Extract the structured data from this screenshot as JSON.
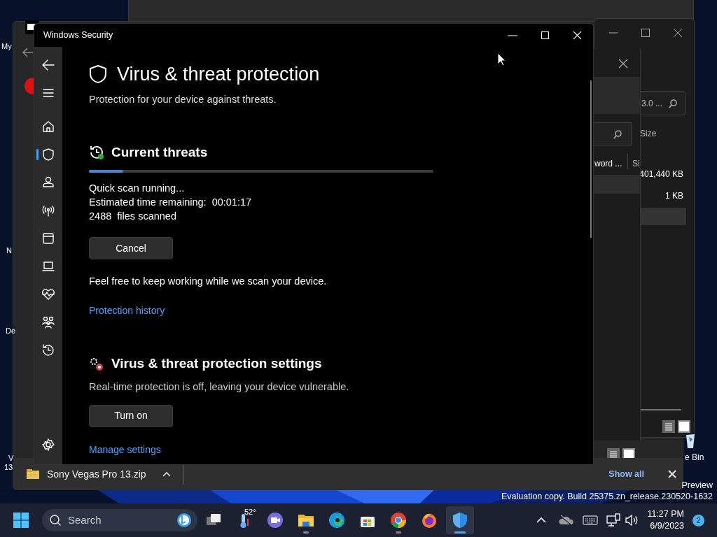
{
  "desktop": {
    "labels": [
      "My",
      "N",
      "De",
      "V",
      "13"
    ],
    "build_info": [
      "Preview",
      "Evaluation copy. Build 25375.zn_release.230520-1632"
    ],
    "recycle_bin_label": "e Bin"
  },
  "browser": {
    "download": {
      "file": "Sony Vegas Pro 13.zip",
      "show_all": "Show all"
    }
  },
  "explorer": {
    "search_value": "3.0 ...",
    "column": "Size",
    "sizes": [
      "401,440 KB",
      "1 KB"
    ]
  },
  "dialog": {
    "column_1": "word ...",
    "column_2": "Si"
  },
  "window": {
    "title": "Windows Security"
  },
  "sidebar": {
    "items": [
      {
        "kind": "home",
        "selected": false
      },
      {
        "kind": "shield",
        "selected": true
      },
      {
        "kind": "person",
        "selected": false
      },
      {
        "kind": "wireless",
        "selected": false
      },
      {
        "kind": "app",
        "selected": false
      },
      {
        "kind": "laptop",
        "selected": false
      },
      {
        "kind": "heart",
        "selected": false
      },
      {
        "kind": "family",
        "selected": false
      },
      {
        "kind": "history",
        "selected": false
      }
    ]
  },
  "page": {
    "title": "Virus & threat protection",
    "subtitle": "Protection for your device against threats."
  },
  "current_threats": {
    "heading": "Current threats",
    "progress": {
      "level": 0.1
    },
    "lines": [
      "Quick scan running...",
      "Estimated time remaining:  00:01:17",
      "2488  files scanned"
    ],
    "button": "Cancel",
    "note": "Feel free to keep working while we scan your device.",
    "link": "Protection history"
  },
  "protection_settings": {
    "heading": "Virus & threat protection settings",
    "status": "Real-time protection is off, leaving your device vulnerable.",
    "button": "Turn on",
    "link": "Manage settings"
  },
  "taskbar": {
    "search_placeholder": "Search",
    "weather": "52°",
    "apps": [
      {
        "kind": "taskview",
        "running": false,
        "selected": false
      },
      {
        "kind": "weather",
        "running": false,
        "selected": false
      },
      {
        "kind": "meet",
        "running": false,
        "selected": false
      },
      {
        "kind": "folder",
        "running": true,
        "selected": false
      },
      {
        "kind": "edge",
        "running": false,
        "selected": false
      },
      {
        "kind": "store",
        "running": false,
        "selected": false
      },
      {
        "kind": "chrome",
        "running": true,
        "selected": false
      },
      {
        "kind": "firefox",
        "running": false,
        "selected": false
      },
      {
        "kind": "defender",
        "running": true,
        "selected": true
      }
    ],
    "time": "11:27 PM",
    "date": "6/9/2023",
    "notifications": "2"
  }
}
